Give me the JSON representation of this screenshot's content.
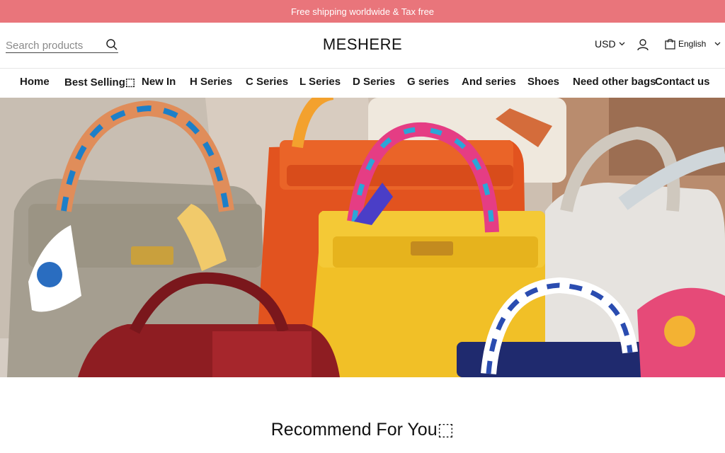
{
  "announcement": "Free shipping worldwide & Tax free",
  "search": {
    "placeholder": "Search products"
  },
  "logo": "MESHERE",
  "currency": "USD",
  "language": "English",
  "nav": [
    "Home",
    "Best Selling⬚",
    "New In",
    "H Series",
    "C Series",
    "L Series",
    "D Series",
    "G series",
    "And series",
    "Shoes",
    "Need other bags",
    "Contact us"
  ],
  "section_title": "Recommend For You⬚",
  "colors": {
    "announce_bg": "#e9757b",
    "text": "#111111"
  },
  "icons": [
    "search-icon",
    "chevron-down-icon",
    "user-icon",
    "shopping-bag-icon"
  ]
}
